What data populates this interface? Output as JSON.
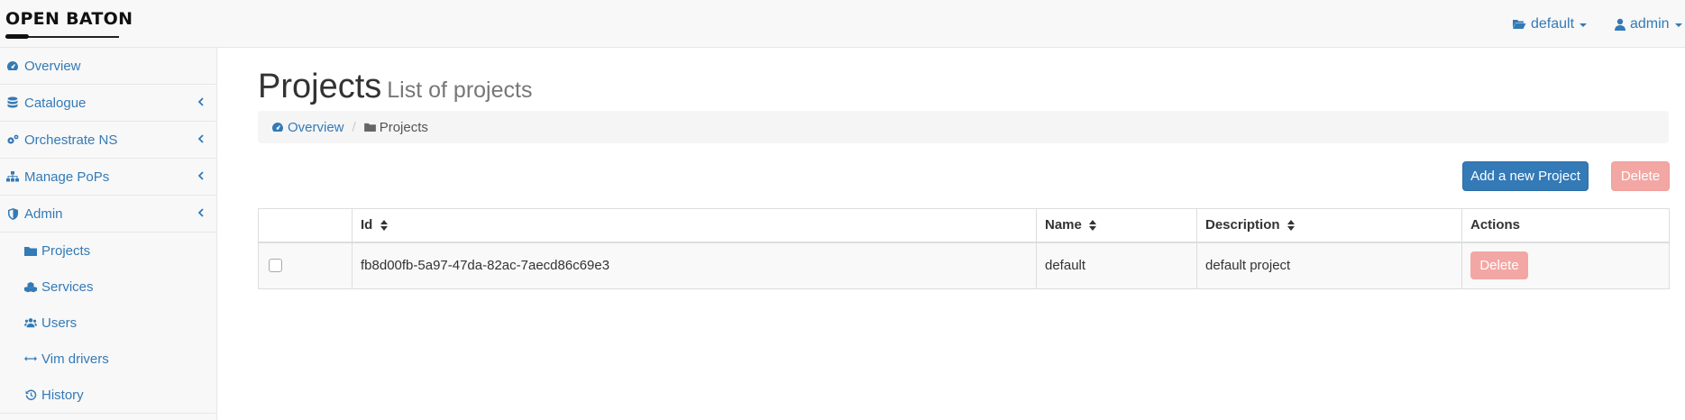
{
  "brand": {
    "logo_text": "OPEN BATON"
  },
  "navbar": {
    "project_label": "default",
    "user_label": "admin"
  },
  "sidebar": {
    "items": [
      {
        "label": "Overview",
        "icon": "dashboard-icon"
      },
      {
        "label": "Catalogue",
        "icon": "database-icon"
      },
      {
        "label": "Orchestrate NS",
        "icon": "cogs-icon"
      },
      {
        "label": "Manage PoPs",
        "icon": "sitemap-icon"
      },
      {
        "label": "Admin",
        "icon": "shield-icon"
      }
    ],
    "admin_subitems": [
      {
        "label": "Projects",
        "icon": "folder-icon"
      },
      {
        "label": "Services",
        "icon": "cubes-icon"
      },
      {
        "label": "Users",
        "icon": "users-icon"
      },
      {
        "label": "Vim drivers",
        "icon": "arrows-h-icon"
      },
      {
        "label": "History",
        "icon": "history-icon"
      }
    ]
  },
  "main": {
    "title": "Projects",
    "subtitle": "List of projects",
    "breadcrumb": [
      {
        "label": "Overview",
        "icon": "dashboard-icon"
      },
      {
        "label": "Projects",
        "icon": "folder-icon"
      }
    ],
    "add_button_label": "Add a new Project",
    "delete_button_label": "Delete"
  },
  "table": {
    "headers": [
      "Id",
      "Name",
      "Description",
      "Actions"
    ],
    "rows": [
      {
        "id": "fb8d00fb-5a97-47da-82ac-7aecd86c69e3",
        "name": "default",
        "description": "default project",
        "action_label": "Delete"
      }
    ]
  },
  "colors": {
    "link": "#337ab7",
    "primary_button": "#337ab7",
    "danger_disabled": "#f2a7a4",
    "sidebar_bg": "#f8f8f8"
  }
}
